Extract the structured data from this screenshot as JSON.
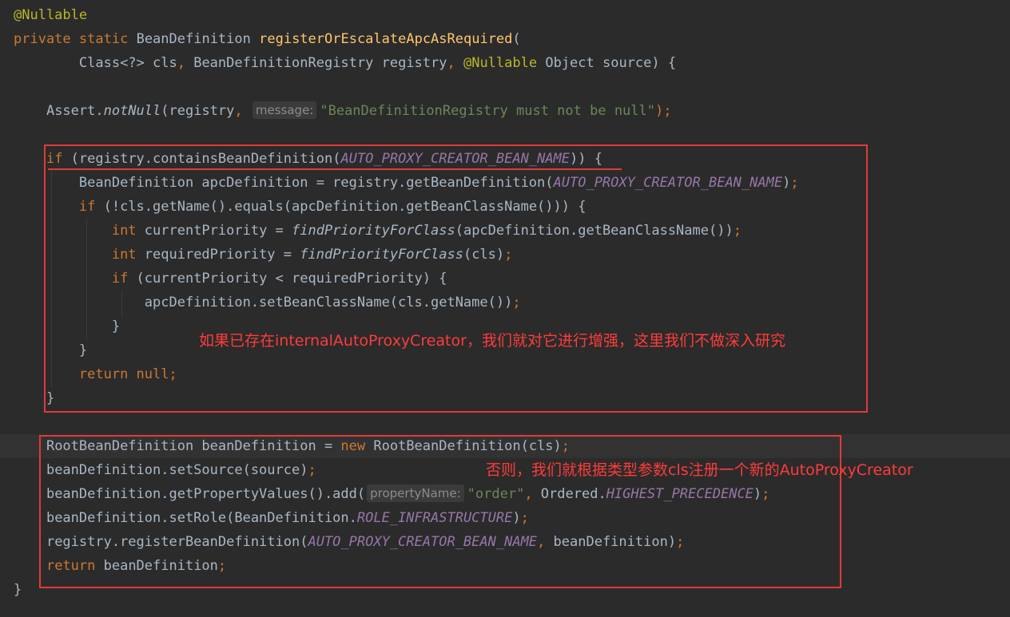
{
  "editor": {
    "lines": {
      "l1": {
        "annotation": "@Nullable"
      },
      "l2": {
        "kw_private": "private",
        "kw_static": "static",
        "type": "BeanDefinition",
        "method": "registerOrEscalateApcAsRequired",
        "open": "("
      },
      "l3": {
        "indent": "        ",
        "p1": "Class<?> cls",
        "comma1": ",",
        "p2": " BeanDefinitionRegistry registry",
        "comma2": ",",
        "annotation": " @Nullable",
        "p3": " Object source) {"
      },
      "l5": {
        "indent": "    ",
        "a": "Assert.",
        "b": "notNull",
        "c": "(registry",
        "comma": ",",
        "hint": "message:",
        "str": "\"BeanDefinitionRegistry must not be null\"",
        "end": ");"
      },
      "l7": {
        "indent": "    ",
        "kw": "if",
        "a": " (registry.containsBeanDefinition(",
        "konst": "AUTO_PROXY_CREATOR_BEAN_NAME",
        "b": ")) {"
      },
      "l8": {
        "indent": "        ",
        "a": "BeanDefinition apcDefinition = registry.getBeanDefinition(",
        "konst": "AUTO_PROXY_CREATOR_BEAN_NAME",
        "b": ")",
        "semi": ";"
      },
      "l9": {
        "indent": "        ",
        "kw": "if",
        "a": " (!cls.getName().equals(apcDefinition.getBeanClassName())) {"
      },
      "l10": {
        "indent": "            ",
        "kw": "int",
        "a": " currentPriority = ",
        "fn": "findPriorityForClass",
        "b": "(apcDefinition.getBeanClassName())",
        "semi": ";"
      },
      "l11": {
        "indent": "            ",
        "kw": "int",
        "a": " requiredPriority = ",
        "fn": "findPriorityForClass",
        "b": "(cls)",
        "semi": ";"
      },
      "l12": {
        "indent": "            ",
        "kw": "if",
        "a": " (currentPriority < requiredPriority) {"
      },
      "l13": {
        "indent": "                ",
        "a": "apcDefinition.setBeanClassName(cls.getName())",
        "semi": ";"
      },
      "l14": {
        "indent": "            ",
        "a": "}"
      },
      "l15": {
        "indent": "        ",
        "a": "}"
      },
      "l16": {
        "indent": "        ",
        "kw1": "return",
        "kw2": " null",
        "semi": ";"
      },
      "l17": {
        "indent": "    ",
        "a": "}"
      },
      "l19": {
        "indent": "    ",
        "a": "RootBeanDefinition beanDefinition = ",
        "kw": "new",
        "b": " RootBeanDefinition(cls)",
        "semi": ";"
      },
      "l20": {
        "indent": "    ",
        "a": "beanDefinition.setSource(source)",
        "semi": ";"
      },
      "l21": {
        "indent": "    ",
        "a": "beanDefinition.getPropertyValues().add(",
        "hint": "propertyName:",
        "str": "\"order\"",
        "comma": ",",
        "b": " Ordered.",
        "konst": "HIGHEST_PRECEDENCE",
        "c": ")",
        "semi": ";"
      },
      "l22": {
        "indent": "    ",
        "a": "beanDefinition.setRole(BeanDefinition.",
        "konst": "ROLE_INFRASTRUCTURE",
        "b": ")",
        "semi": ";"
      },
      "l23": {
        "indent": "    ",
        "a": "registry.registerBeanDefinition(",
        "konst": "AUTO_PROXY_CREATOR_BEAN_NAME",
        "comma": ",",
        "b": " beanDefinition)",
        "semi": ";"
      },
      "l24": {
        "indent": "    ",
        "kw": "return",
        "a": " beanDefinition",
        "semi": ";"
      },
      "l25": {
        "a": "}"
      }
    }
  },
  "notes": {
    "first": "如果已存在internalAutoProxyCreator，我们就对它进行增强，这里我们不做深入研究",
    "second": "否则，我们就根据类型参数cls注册一个新的AutoProxyCreator"
  },
  "colors": {
    "background": "#2b2b2b",
    "text": "#a9b7c6",
    "keyword": "#cc7832",
    "string": "#6a8759",
    "constant": "#9876aa",
    "method_declaration": "#ffc66d",
    "annotation": "#bbb529",
    "highlight": "#e03a3a"
  }
}
